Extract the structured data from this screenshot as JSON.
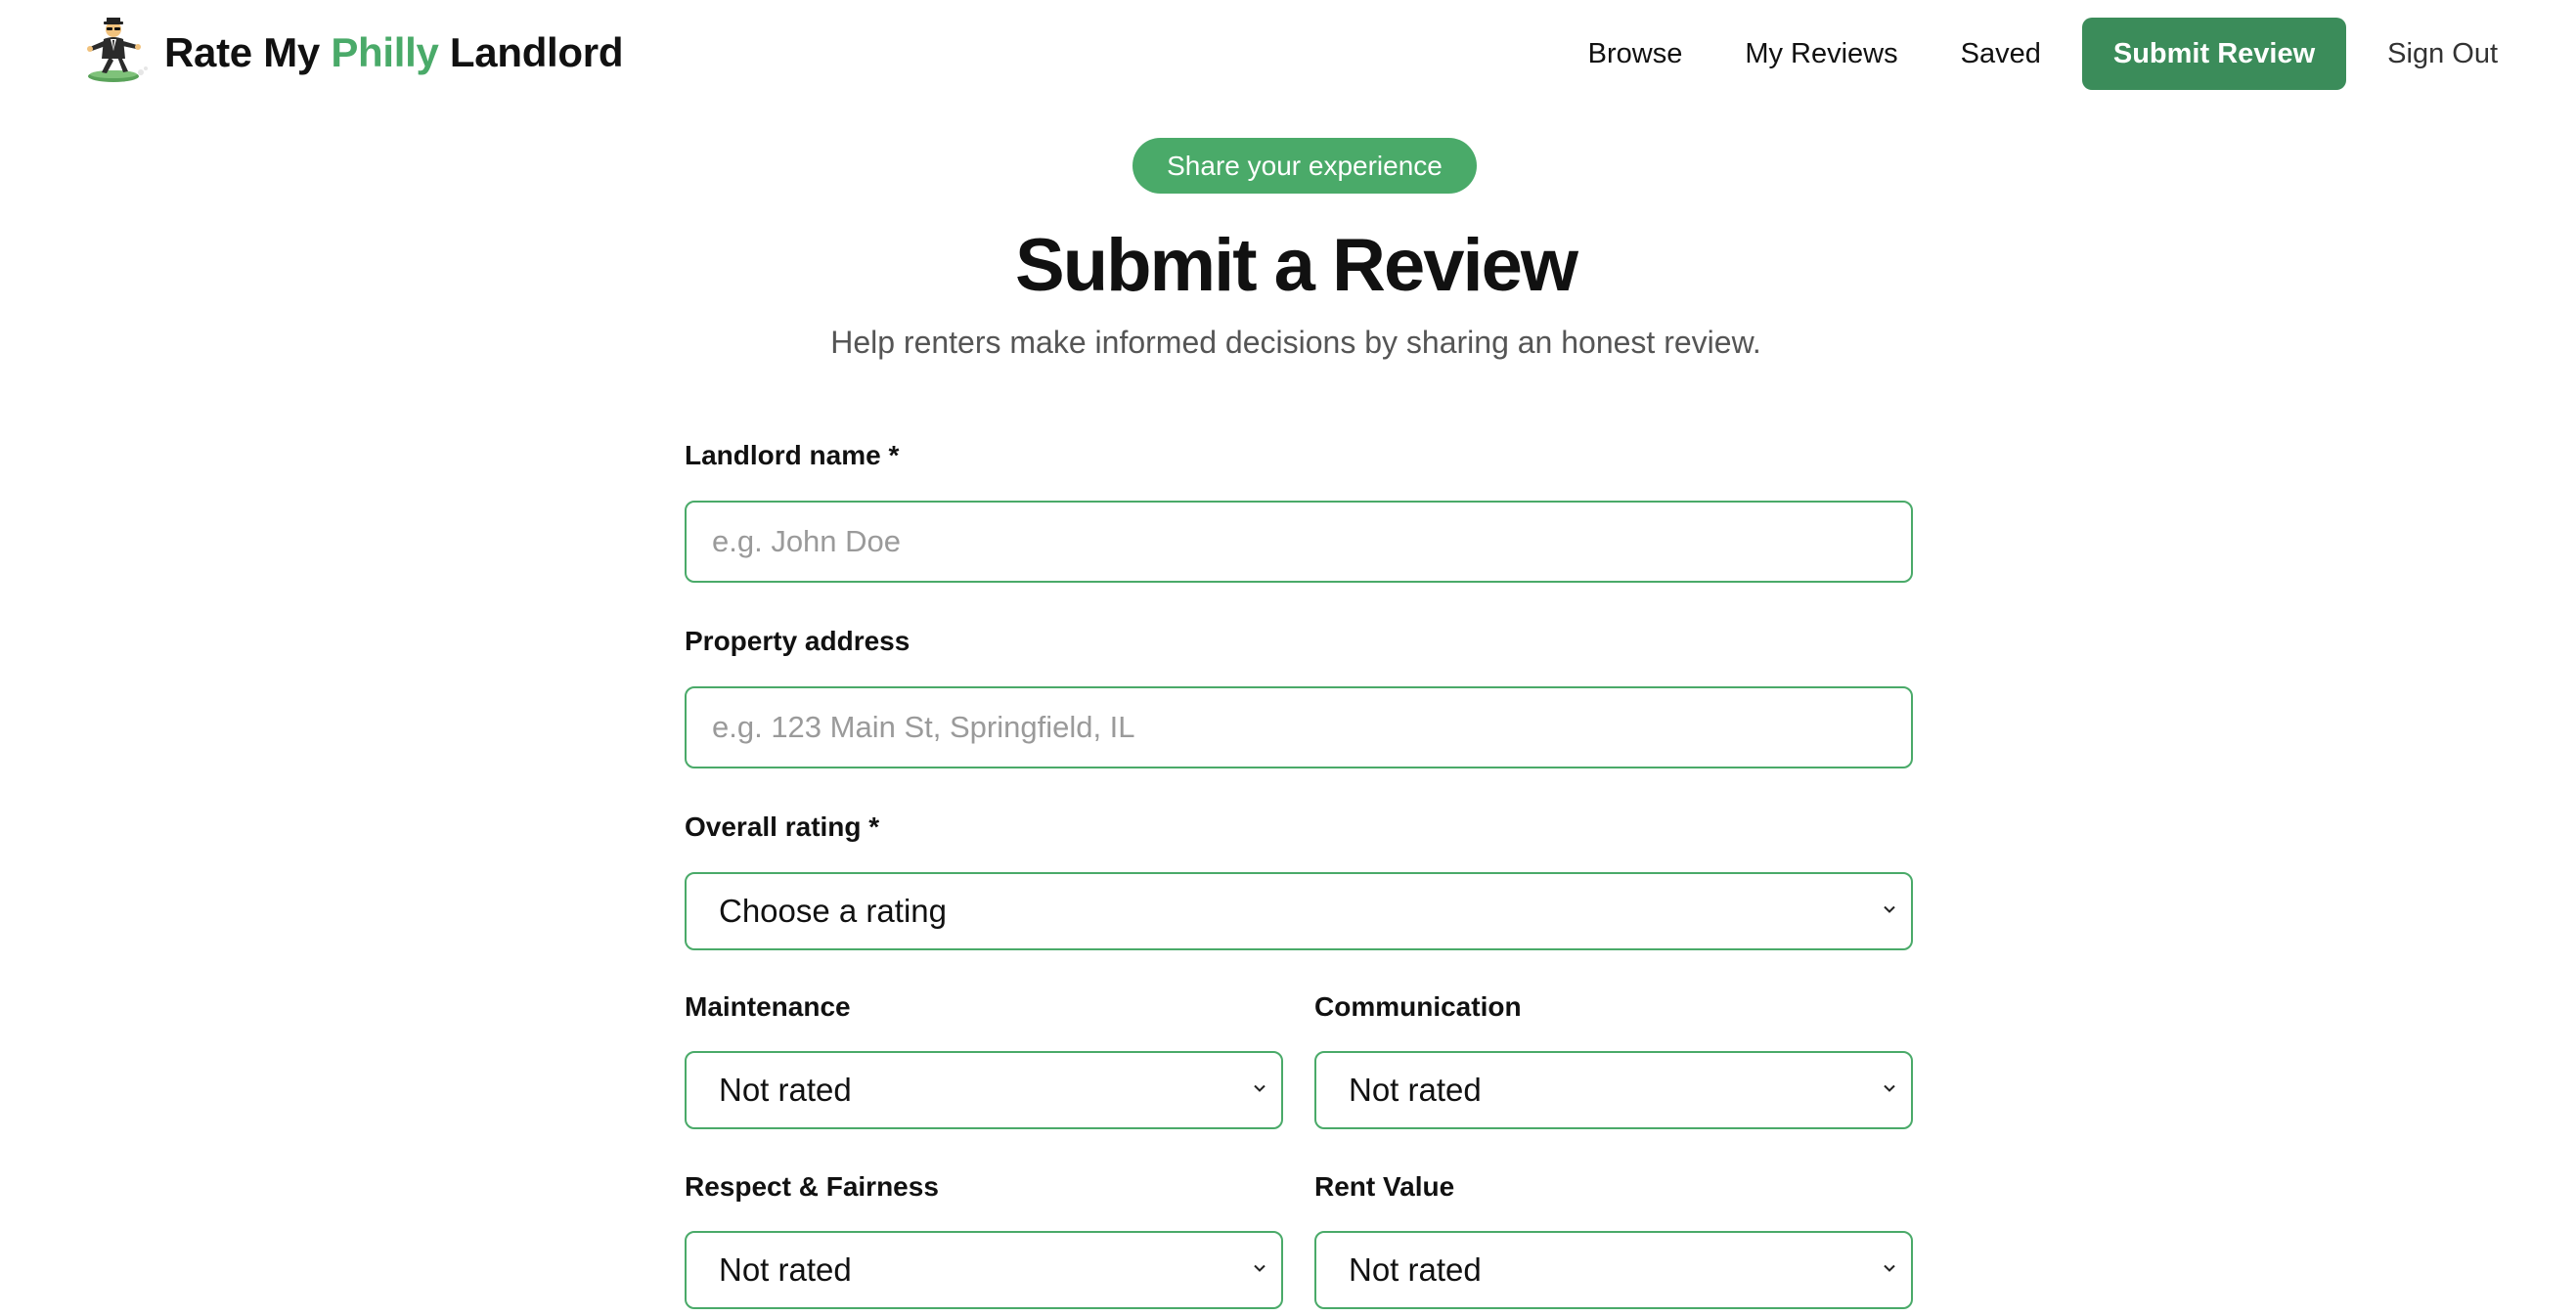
{
  "header": {
    "brand_prefix": "Rate My ",
    "brand_accent": "Philly",
    "brand_suffix": " Landlord",
    "mascot_icon": "businessman-levitating-icon",
    "nav": {
      "browse": "Browse",
      "my_reviews": "My Reviews",
      "saved": "Saved",
      "submit_review": "Submit Review",
      "sign_out": "Sign Out"
    }
  },
  "hero": {
    "pill": "Share your experience",
    "title": "Submit a Review",
    "subtitle": "Help renters make informed decisions by sharing an honest review."
  },
  "form": {
    "landlord_name": {
      "label": "Landlord name *",
      "placeholder": "e.g. John Doe",
      "value": ""
    },
    "property_address": {
      "label": "Property address",
      "placeholder": "e.g. 123 Main St, Springfield, IL",
      "value": ""
    },
    "overall_rating": {
      "label": "Overall rating *",
      "selected": "Choose a rating"
    },
    "maintenance": {
      "label": "Maintenance",
      "selected": "Not rated"
    },
    "communication": {
      "label": "Communication",
      "selected": "Not rated"
    },
    "respect_fairness": {
      "label": "Respect & Fairness",
      "selected": "Not rated"
    },
    "rent_value": {
      "label": "Rent Value",
      "selected": "Not rated"
    }
  },
  "colors": {
    "accent": "#4aaa69",
    "cta": "#3b8c5a",
    "border": "#4aaa69",
    "muted_text": "#555555",
    "placeholder": "#9a9a9a"
  }
}
